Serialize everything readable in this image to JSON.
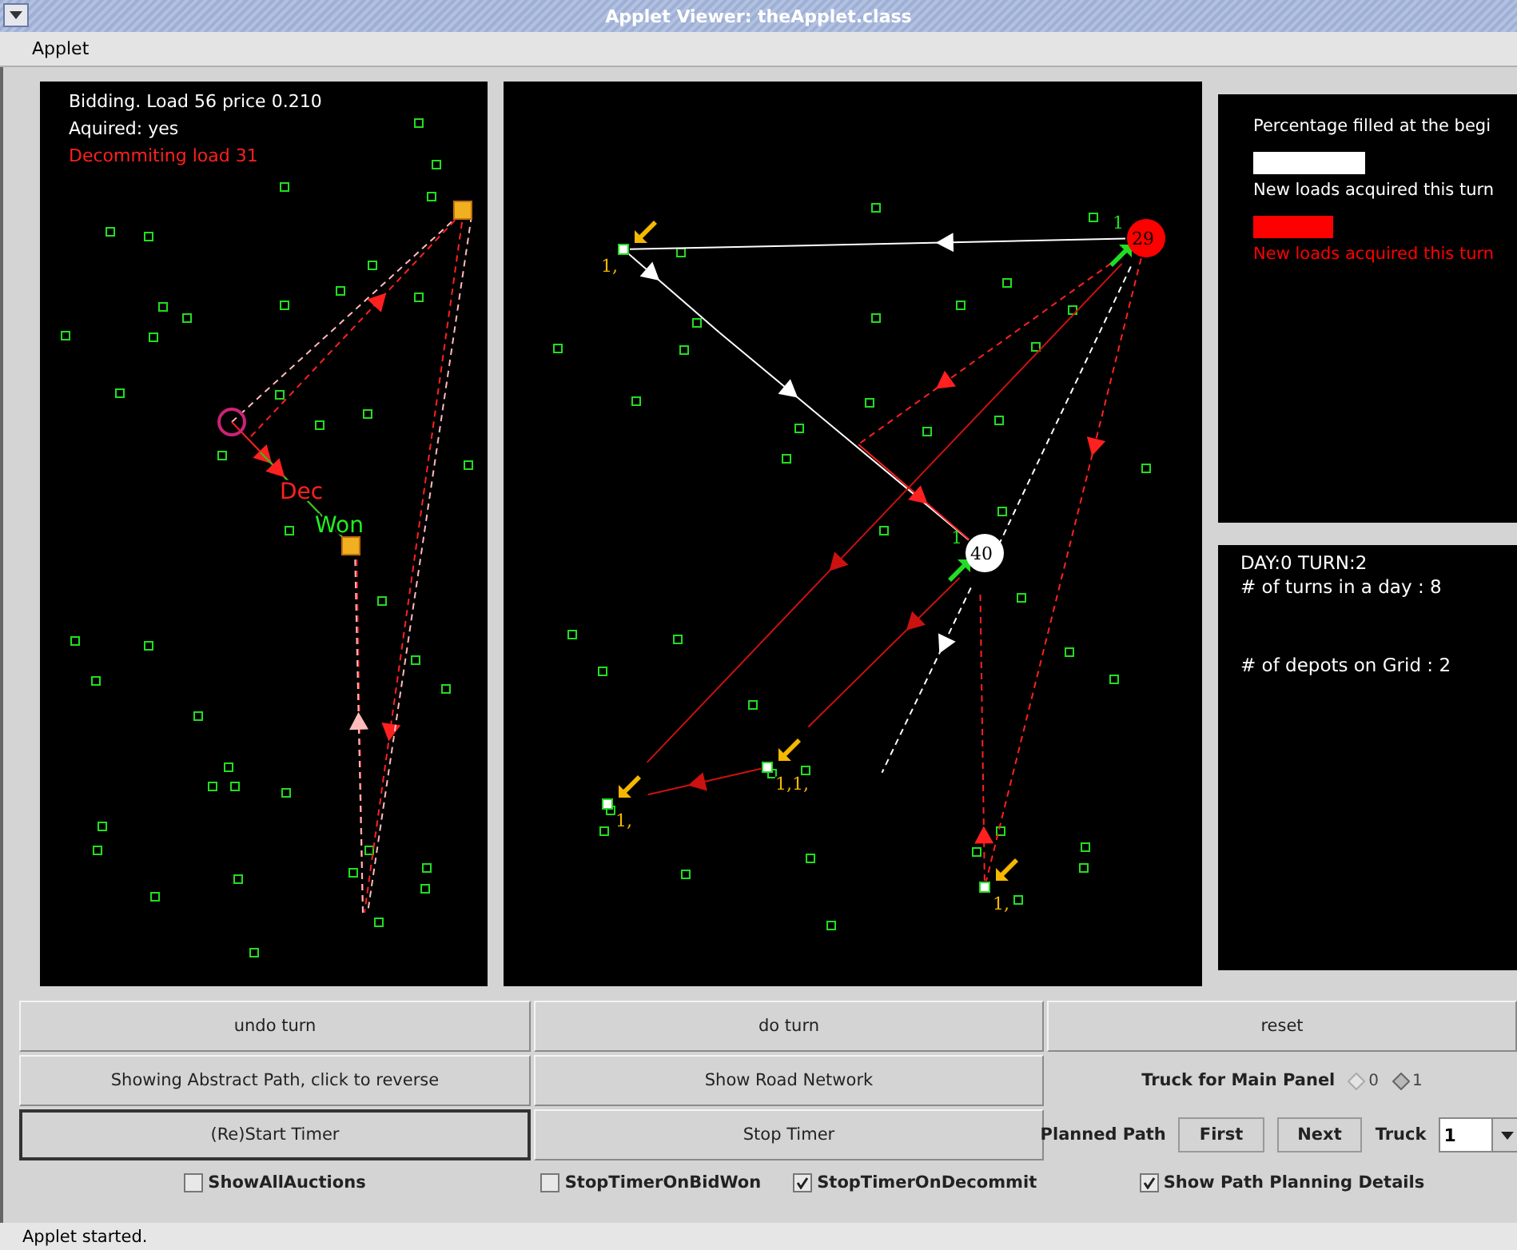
{
  "window": {
    "title": "Applet Viewer: theApplet.class"
  },
  "menu": [
    "Applet"
  ],
  "bidding_map": {
    "status_lines": [
      {
        "text": "Bidding. Load 56 price 0.210",
        "kind": "info"
      },
      {
        "text": "Aquired: yes",
        "kind": "info"
      },
      {
        "text": "Decommiting load 31",
        "kind": "alert"
      }
    ],
    "event_labels": [
      {
        "text": "Dec",
        "kind": "decommit"
      },
      {
        "text": "Won",
        "kind": "won"
      }
    ]
  },
  "main_map": {
    "depots": [
      {
        "label": "29",
        "color": "#ff0000",
        "truck_count": "1"
      },
      {
        "label": "40",
        "color": "#ffffff",
        "truck_count": "1"
      }
    ],
    "stop_labels": [
      "1,",
      "1,1,",
      "1,",
      "1,"
    ]
  },
  "legend": {
    "title": "Percentage filled at the begi",
    "items": [
      {
        "label": "New loads acquired this turn",
        "color": "#ffffff"
      },
      {
        "label": "New loads acquired this turn",
        "color": "#ff0000"
      }
    ]
  },
  "info": [
    "DAY:0 TURN:2",
    "# of turns in a day : 8",
    "# of depots on Grid : 2"
  ],
  "button_rows": [
    [
      {
        "label": "undo turn",
        "focused": false
      },
      {
        "label": "do turn",
        "focused": false
      },
      {
        "label": "reset",
        "focused": false
      }
    ],
    [
      {
        "label": "Showing Abstract Path, click to reverse",
        "focused": false
      },
      {
        "label": "Show Road Network",
        "focused": false
      }
    ],
    [
      {
        "label": "(Re)Start Timer",
        "focused": true
      },
      {
        "label": "Stop Timer",
        "focused": false
      }
    ]
  ],
  "truck_selector": {
    "label": "Truck for  Main Panel",
    "options": [
      {
        "label": "0",
        "selected": false
      },
      {
        "label": "1",
        "selected": true
      }
    ]
  },
  "planned_path": {
    "label": "Planned Path",
    "buttons": [
      "First",
      "Next"
    ],
    "truck_label": "Truck",
    "truck_value": "1"
  },
  "checkbox_cells": [
    [
      {
        "label": "ShowAllAuctions",
        "checked": false
      }
    ],
    [
      {
        "label": "StopTimerOnBidWon",
        "checked": false
      },
      {
        "label": "StopTimerOnDecommit",
        "checked": true
      }
    ],
    [
      {
        "label": "Show Path Planning Details",
        "checked": true
      }
    ]
  ],
  "status_bar": "Applet started."
}
